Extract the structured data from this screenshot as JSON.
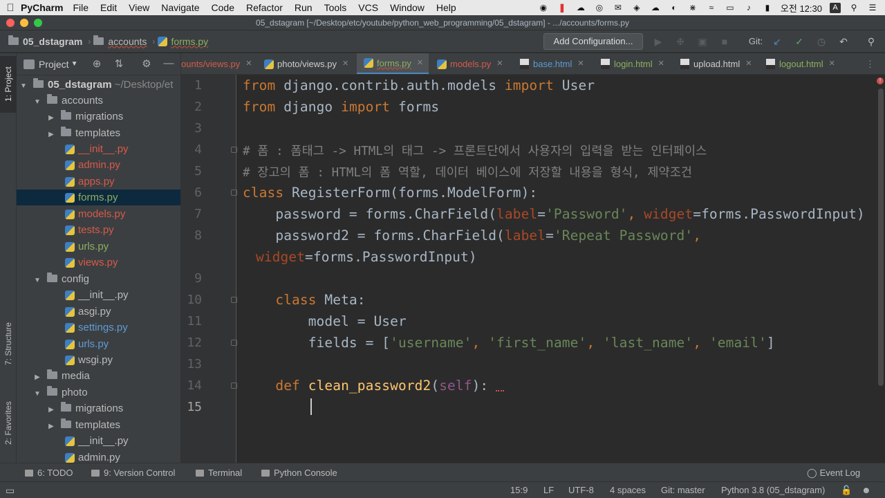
{
  "menubar": {
    "app_name": "PyCharm",
    "items": [
      "File",
      "Edit",
      "View",
      "Navigate",
      "Code",
      "Refactor",
      "Run",
      "Tools",
      "VCS",
      "Window",
      "Help"
    ],
    "clock": "오전 12:30",
    "input_source": "A"
  },
  "window": {
    "title": "05_dstagram [~/Desktop/etc/youtube/python_web_programming/05_dstagram] - .../accounts/forms.py"
  },
  "navbar": {
    "breadcrumbs": [
      "05_dstagram",
      "accounts",
      "forms.py"
    ],
    "run_config": "Add Configuration...",
    "git_label": "Git:"
  },
  "left_strip": {
    "project_tab": "1: Project",
    "structure_tab": "7: Structure",
    "favorites_tab": "2: Favorites"
  },
  "project": {
    "header_label": "Project",
    "root_name": "05_dstagram",
    "root_path": "~/Desktop/et",
    "tree": {
      "accounts": "accounts",
      "migrations": "migrations",
      "templates": "templates",
      "init": "__init__.py",
      "admin": "admin.py",
      "apps": "apps.py",
      "forms": "forms.py",
      "models": "models.py",
      "tests": "tests.py",
      "urls": "urls.py",
      "views": "views.py",
      "config": "config",
      "config_init": "__init__.py",
      "asgi": "asgi.py",
      "settings": "settings.py",
      "config_urls": "urls.py",
      "wsgi": "wsgi.py",
      "media": "media",
      "photo": "photo",
      "photo_migrations": "migrations",
      "photo_templates": "templates",
      "photo_init": "__init__.py",
      "photo_admin": "admin.py"
    }
  },
  "tabs": [
    "ounts/views.py",
    "photo/views.py",
    "forms.py",
    "models.py",
    "base.html",
    "login.html",
    "upload.html",
    "logout.html"
  ],
  "editor": {
    "line_numbers": [
      "1",
      "2",
      "3",
      "4",
      "5",
      "6",
      "7",
      "8",
      "9",
      "10",
      "11",
      "12",
      "13",
      "14",
      "15"
    ],
    "l1": {
      "from": "from",
      "module": " django.contrib.auth.models ",
      "import": "import",
      "name": " User"
    },
    "l2": {
      "from": "from",
      "module": " django ",
      "import": "import",
      "name": " forms"
    },
    "l4": "# 폼 : 폼태그 -> HTML의 태그 -> 프론트단에서 사용자의 입력을 받는 인터페이스",
    "l5": "# 장고의 폼 : HTML의 폼 역할, 데이터 베이스에 저장할 내용을 형식, 제약조건",
    "l6": {
      "class": "class",
      "rest": " RegisterForm(forms.ModelForm):"
    },
    "l7": {
      "lead": "    password = forms.CharField(",
      "p1": "label",
      "eq1": "=",
      "s1": "'Password'",
      "comma": ", ",
      "p2": "widget",
      "rest": "=forms.PasswordInput)"
    },
    "l8": {
      "lead": "    password2 = forms.CharField(",
      "p1": "label",
      "eq1": "=",
      "s1": "'Repeat Password'",
      "comma": ","
    },
    "l8b": {
      "p2": "widget",
      "rest": "=forms.PasswordInput)"
    },
    "l10": {
      "class": "class",
      "rest": " Meta:"
    },
    "l11": "        model = User",
    "l12": {
      "lead": "        fields = [",
      "s1": "'username'",
      "c1": ", ",
      "s2": "'first_name'",
      "c2": ", ",
      "s3": "'last_name'",
      "c3": ", ",
      "s4": "'email'",
      "end": "]"
    },
    "l14": {
      "def": "def",
      "fname": "clean_password2",
      "open": "(",
      "self": "self",
      "close": "):"
    }
  },
  "bottom_tools": [
    "6: TODO",
    "9: Version Control",
    "Terminal",
    "Python Console",
    "Event Log"
  ],
  "status": {
    "position": "15:9",
    "line_sep": "LF",
    "encoding": "UTF-8",
    "indent": "4 spaces",
    "branch": "Git: master",
    "interpreter": "Python 3.8 (05_dstagram)"
  }
}
